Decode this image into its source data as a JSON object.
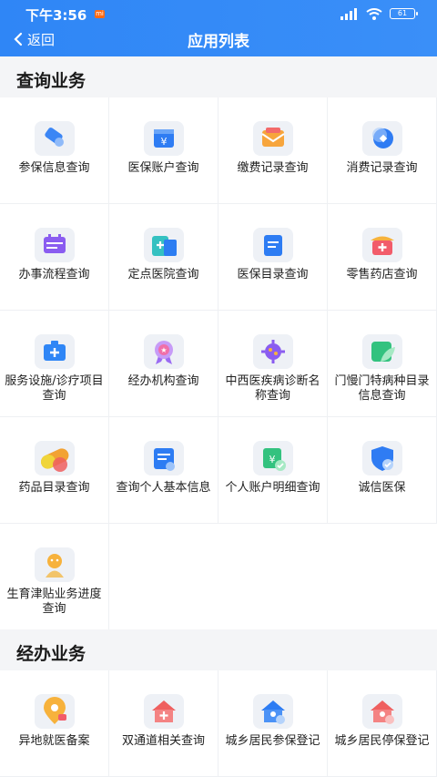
{
  "status_bar": {
    "time": "下午3:56",
    "mi_badge": "mi",
    "battery": "61"
  },
  "nav": {
    "back_label": "返回",
    "title": "应用列表"
  },
  "sections": [
    {
      "title": "查询业务",
      "items": [
        {
          "label": "参保信息查询",
          "icon": "insurance-tag-icon"
        },
        {
          "label": "医保账户查询",
          "icon": "wallet-yuan-icon"
        },
        {
          "label": "缴费记录查询",
          "icon": "payment-envelope-icon"
        },
        {
          "label": "消费记录查询",
          "icon": "coin-disc-icon"
        },
        {
          "label": "办事流程查询",
          "icon": "calendar-flow-icon"
        },
        {
          "label": "定点医院查询",
          "icon": "hospital-building-icon"
        },
        {
          "label": "医保目录查询",
          "icon": "document-list-icon"
        },
        {
          "label": "零售药店查询",
          "icon": "pharmacy-store-icon"
        },
        {
          "label": "服务设施/诊疗项目查询",
          "icon": "medical-kit-icon"
        },
        {
          "label": "经办机构查询",
          "icon": "medal-star-icon"
        },
        {
          "label": "中西医疾病诊断名称查询",
          "icon": "virus-icon"
        },
        {
          "label": "门慢门特病种目录信息查询",
          "icon": "leaf-card-icon"
        },
        {
          "label": "药品目录查询",
          "icon": "capsule-icon"
        },
        {
          "label": "查询个人基本信息",
          "icon": "profile-card-icon"
        },
        {
          "label": "个人账户明细查询",
          "icon": "account-check-icon"
        },
        {
          "label": "诚信医保",
          "icon": "shield-check-icon"
        },
        {
          "label": "生育津贴业务进度查询",
          "icon": "baby-icon"
        }
      ]
    },
    {
      "title": "经办业务",
      "items": [
        {
          "label": "异地就医备案",
          "icon": "location-pin-icon"
        },
        {
          "label": "双通道相关查询",
          "icon": "house-cross-icon"
        },
        {
          "label": "城乡居民参保登记",
          "icon": "house-person-icon"
        },
        {
          "label": "城乡居民停保登记",
          "icon": "house-stop-icon"
        }
      ]
    }
  ],
  "colors": {
    "header": "#2f86f6",
    "section_bg": "#f4f5f7",
    "icon_bg": "#eef1f6",
    "divider": "#eef0f3"
  }
}
